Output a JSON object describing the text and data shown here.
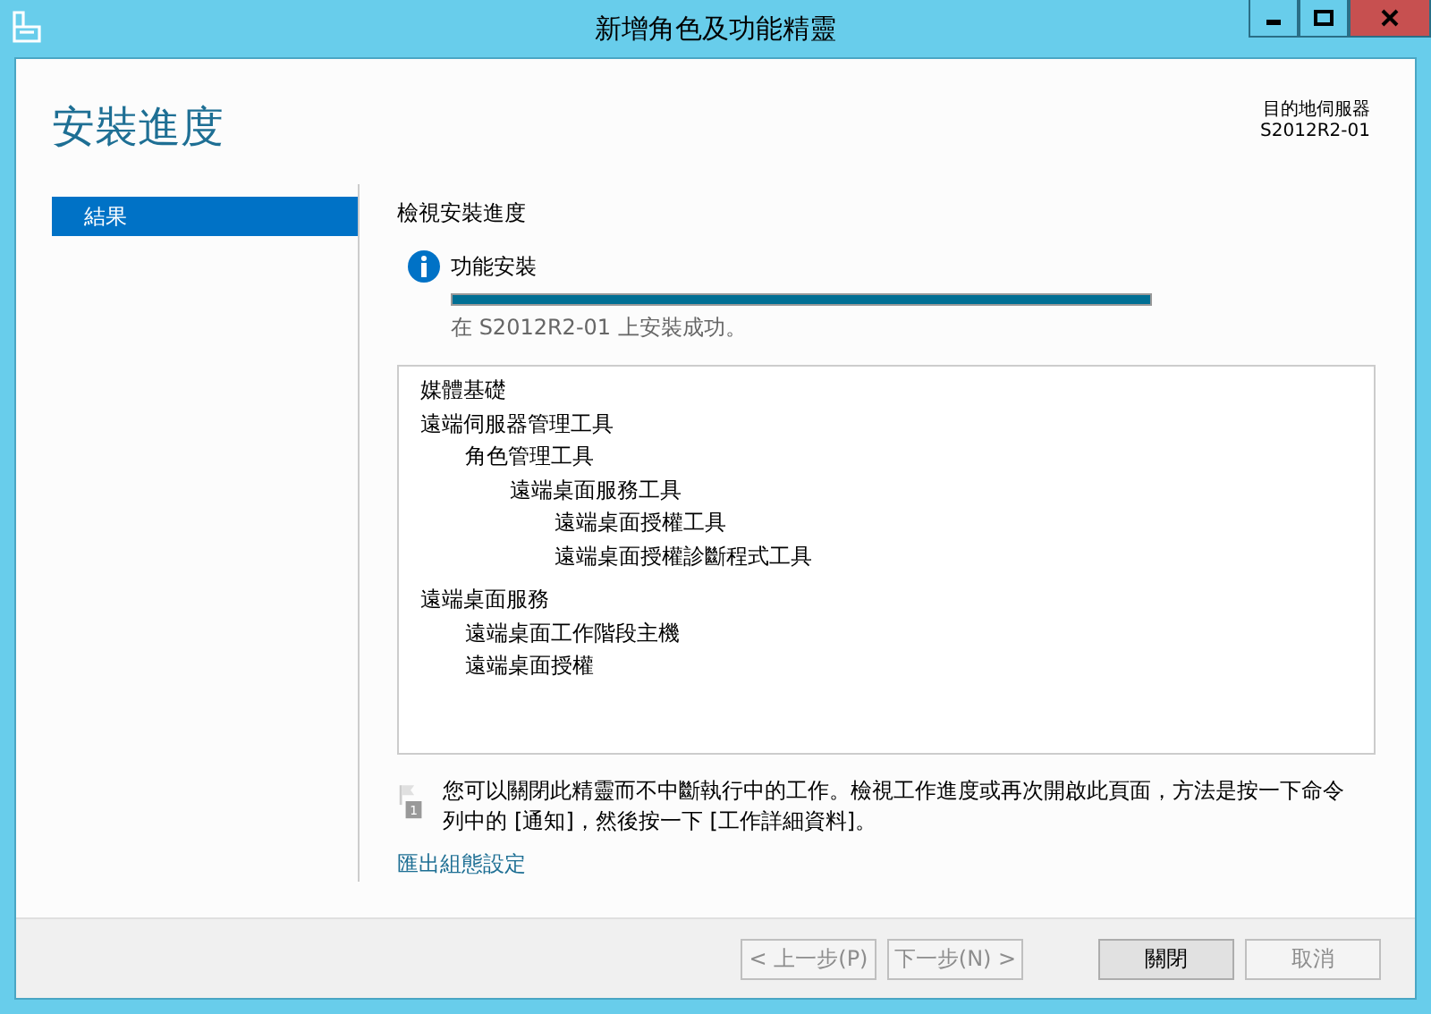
{
  "window": {
    "title": "新增角色及功能精靈"
  },
  "header": {
    "title": "安裝進度",
    "destination_label": "目的地伺服器",
    "destination_server": "S2012R2-01"
  },
  "sidebar": {
    "items": [
      {
        "label": "結果",
        "selected": true
      }
    ]
  },
  "content": {
    "heading": "檢視安裝進度",
    "status": {
      "label": "功能安裝",
      "level": 1,
      "message": "在 S2012R2-01 上安裝成功。"
    },
    "features": [
      {
        "label": "媒體基礎"
      },
      {
        "label": "遠端伺服器管理工具",
        "children": [
          {
            "label": "角色管理工具",
            "children": [
              {
                "label": "遠端桌面服務工具",
                "children": [
                  {
                    "label": "遠端桌面授權工具"
                  },
                  {
                    "label": "遠端桌面授權診斷程式工具"
                  }
                ]
              }
            ]
          }
        ]
      },
      {
        "label": "遠端桌面服務",
        "children": [
          {
            "label": "遠端桌面工作階段主機"
          },
          {
            "label": "遠端桌面授權"
          }
        ]
      }
    ],
    "notice": {
      "badge": "1",
      "text": "您可以關閉此精靈而不中斷執行中的工作。檢視工作進度或再次開啟此頁面，方法是按一下命令列中的 [通知]，然後按一下 [工作詳細資料]。"
    },
    "export_link": "匯出組態設定"
  },
  "buttons": [
    {
      "label": "< 上一步(P)",
      "disabled": true,
      "kind": "nav"
    },
    {
      "label": "下一步(N) >",
      "disabled": true,
      "kind": "nav"
    },
    {
      "label": "關閉",
      "disabled": false,
      "kind": "main"
    },
    {
      "label": "取消",
      "disabled": true,
      "kind": "main"
    }
  ]
}
